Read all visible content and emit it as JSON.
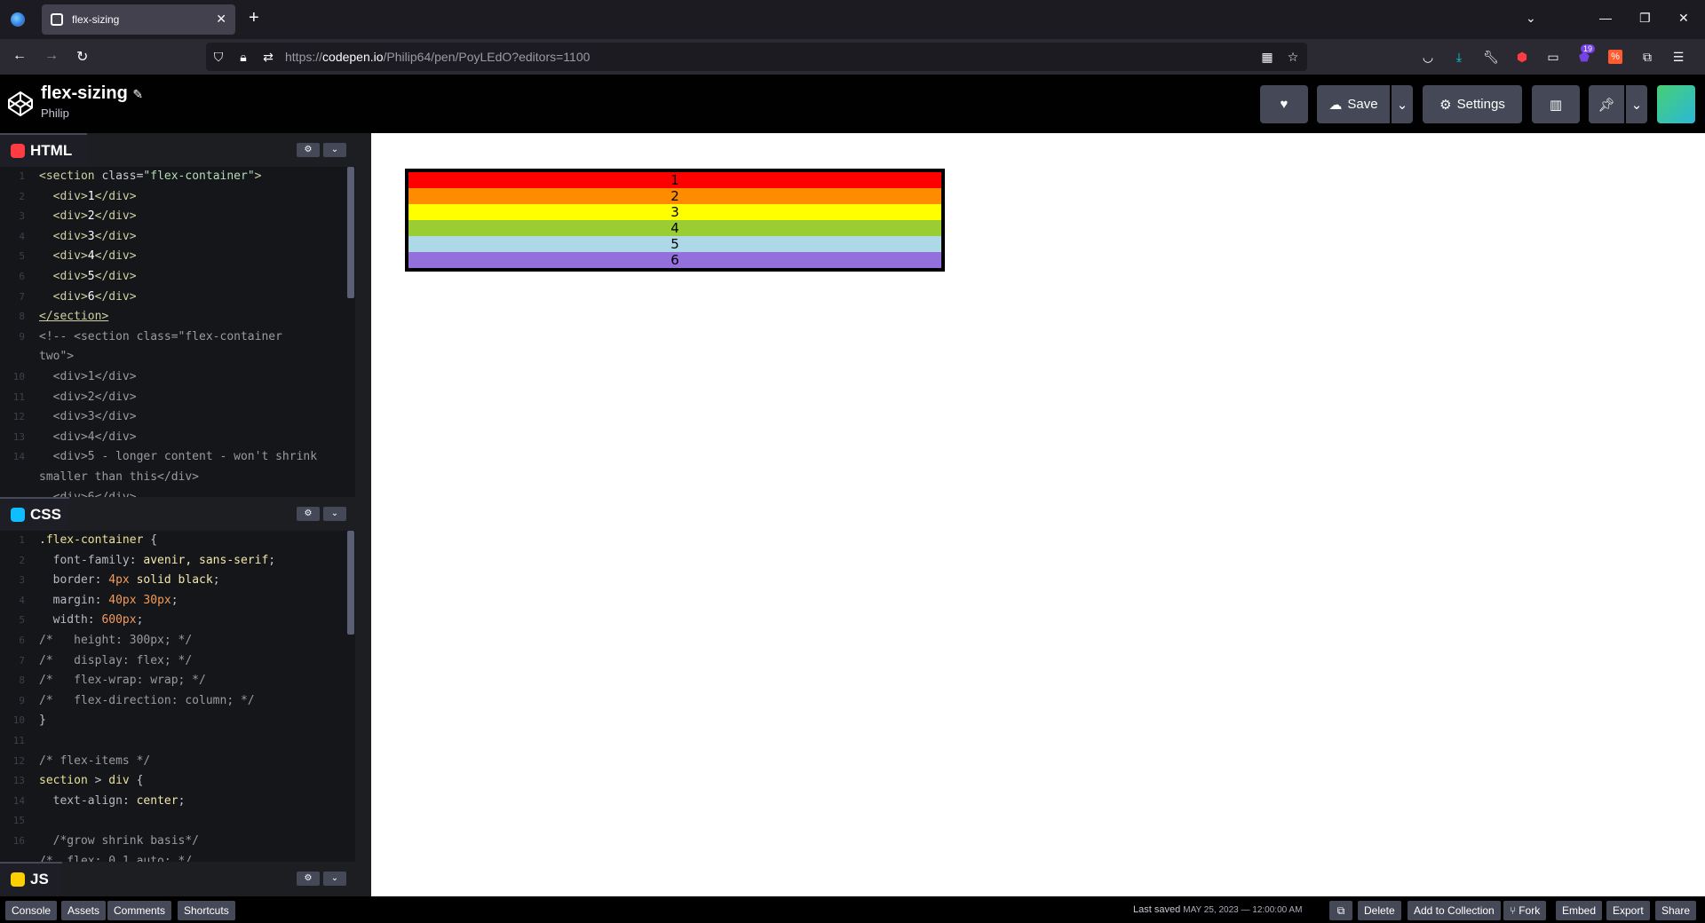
{
  "browser": {
    "tab_title": "flex-sizing",
    "url_prefix": "https://",
    "url_host": "codepen.io",
    "url_path": "/Philip64/pen/PoyLEdO?editors=1100",
    "extension_badge": "19"
  },
  "header": {
    "pen_title": "flex-sizing",
    "owner": "Philip",
    "save_label": "Save",
    "settings_label": "Settings"
  },
  "editors": {
    "html": {
      "label": "HTML",
      "line_numbers": [
        "1",
        "2",
        "3",
        "4",
        "5",
        "6",
        "7",
        "8",
        "9",
        "",
        "10",
        "11",
        "12",
        "13",
        "14",
        ""
      ]
    },
    "css": {
      "label": "CSS",
      "line_numbers": [
        "1",
        "2",
        "3",
        "4",
        "5",
        "6",
        "7",
        "8",
        "9",
        "10",
        "11",
        "12",
        "13",
        "14",
        "15",
        "16"
      ]
    },
    "js": {
      "label": "JS"
    }
  },
  "preview": {
    "items": [
      {
        "label": "1",
        "color": "#ff0000"
      },
      {
        "label": "2",
        "color": "#ff8c00"
      },
      {
        "label": "3",
        "color": "#ffff00"
      },
      {
        "label": "4",
        "color": "#9acd32"
      },
      {
        "label": "5",
        "color": "#add8e6"
      },
      {
        "label": "6",
        "color": "#9370db"
      }
    ]
  },
  "footer": {
    "console": "Console",
    "assets": "Assets",
    "comments": "Comments",
    "shortcuts": "Shortcuts",
    "last_saved_label": "Last saved",
    "last_saved_time": "MAY 25, 2023 — 12:00:00 AM",
    "delete": "Delete",
    "add_to_collection": "Add to Collection",
    "fork": "Fork",
    "embed": "Embed",
    "export": "Export",
    "share": "Share"
  },
  "colors": {
    "html_badge": "#ff3c41",
    "css_badge": "#0ebeff",
    "js_badge": "#fcd000"
  }
}
